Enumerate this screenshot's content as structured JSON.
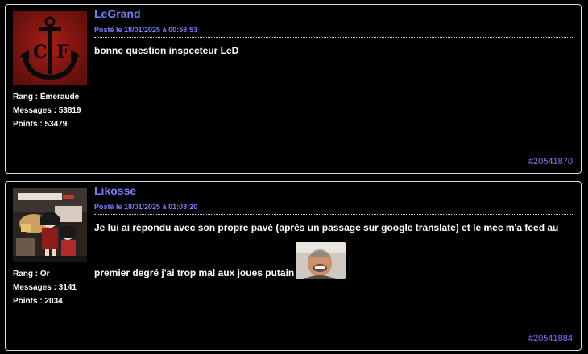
{
  "posts": [
    {
      "author": "LeGrand",
      "date": "Posté le 18/01/2025 à 00:58:53",
      "rank_label": "Rang : ",
      "rank": "Émeraude",
      "messages_label": "Messages : ",
      "messages": "53819",
      "points_label": "Points : ",
      "points": "53479",
      "text_line1": "bonne question inspecteur LeD",
      "post_id": "#20541870",
      "avatar_icon": "anchor-cf-logo",
      "avatar_letters": "C F"
    },
    {
      "author": "Likosse",
      "date": "Posté le 18/01/2025 à 01:03:20",
      "rank_label": "Rang : ",
      "rank": "Or",
      "messages_label": "Messages : ",
      "messages": "3141",
      "points_label": "Points : ",
      "points": "2034",
      "text_line1": "Je lui ai répondu avec son propre pavé (après un passage sur google translate) et le mec m'a feed au",
      "text_line2": "premier degré j'ai trop mal aux joues putain",
      "post_id": "#20541884",
      "avatar_icon": "anime-figure-avatar",
      "sticker_icon": "laughing-man-sticker"
    }
  ],
  "colors": {
    "background": "#000000",
    "border": "#d8d8d8",
    "accent": "#7b7bff",
    "text": "#ffffff"
  }
}
